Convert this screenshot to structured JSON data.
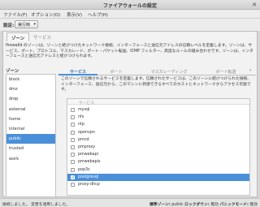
{
  "window": {
    "title": "ファイアウォールの設定"
  },
  "menu": [
    "ファイル(F)",
    "オプション(O)",
    "表示(V)",
    "ヘルプ(H)"
  ],
  "config": {
    "label": "設定:",
    "value": "実行時"
  },
  "tabs": [
    {
      "label": "ゾーン",
      "active": true
    },
    {
      "label": "サービス",
      "active": false
    }
  ],
  "zone_description": "firewalld のゾーンは、ゾーンと結びつけたネットワーク接続、インターフェースと送信元アドレスの信頼レベルを定義します。ゾーンは、サービス、ポート、プロトコル、マスカレード、ポート・パケット転送、ICMP フィルター、高度なルールの組み合わせです。ゾーンは、インターフェースと送信元アドレスと結びつけられます。",
  "zones_header": "ゾーン",
  "zones": [
    "block",
    "dmz",
    "drop",
    "external",
    "home",
    "internal",
    "public",
    "trusted",
    "work"
  ],
  "selected_zone": "public",
  "subtabs": [
    "サービス",
    "ポート",
    "マスカレーディング",
    "ポート転送"
  ],
  "services_description": "このゾーンで信頼されるサービスを定義します。信頼されたサービスは、このゾーンに結びつけられた接続、インターフェース、送信元から、このマシンに到達できるすべてのホストとネットワークからアクセス可能です。",
  "services_header": "サービス",
  "services": [
    {
      "name": "mysql",
      "checked": false
    },
    {
      "name": "nfs",
      "checked": false
    },
    {
      "name": "ntp",
      "checked": false
    },
    {
      "name": "openvpn",
      "checked": false
    },
    {
      "name": "pmcd",
      "checked": false
    },
    {
      "name": "pmproxy",
      "checked": false
    },
    {
      "name": "pmwebapi",
      "checked": false
    },
    {
      "name": "pmwebapis",
      "checked": false
    },
    {
      "name": "pop3s",
      "checked": false
    },
    {
      "name": "postgresql",
      "checked": true
    },
    {
      "name": "proxy-dhcp",
      "checked": false
    }
  ],
  "selected_service": "postgresql",
  "status": {
    "left": "接続しました。 変更を適用しました。",
    "default_zone_label": "標準ゾーン:",
    "default_zone": "public",
    "lockdown_label": "ロックダウン:",
    "lockdown": "無効",
    "panic_label": "パニックモード:",
    "panic": "無効"
  },
  "colors": {
    "selection": "#4a90d9",
    "accent_text": "#2e6fb5"
  }
}
